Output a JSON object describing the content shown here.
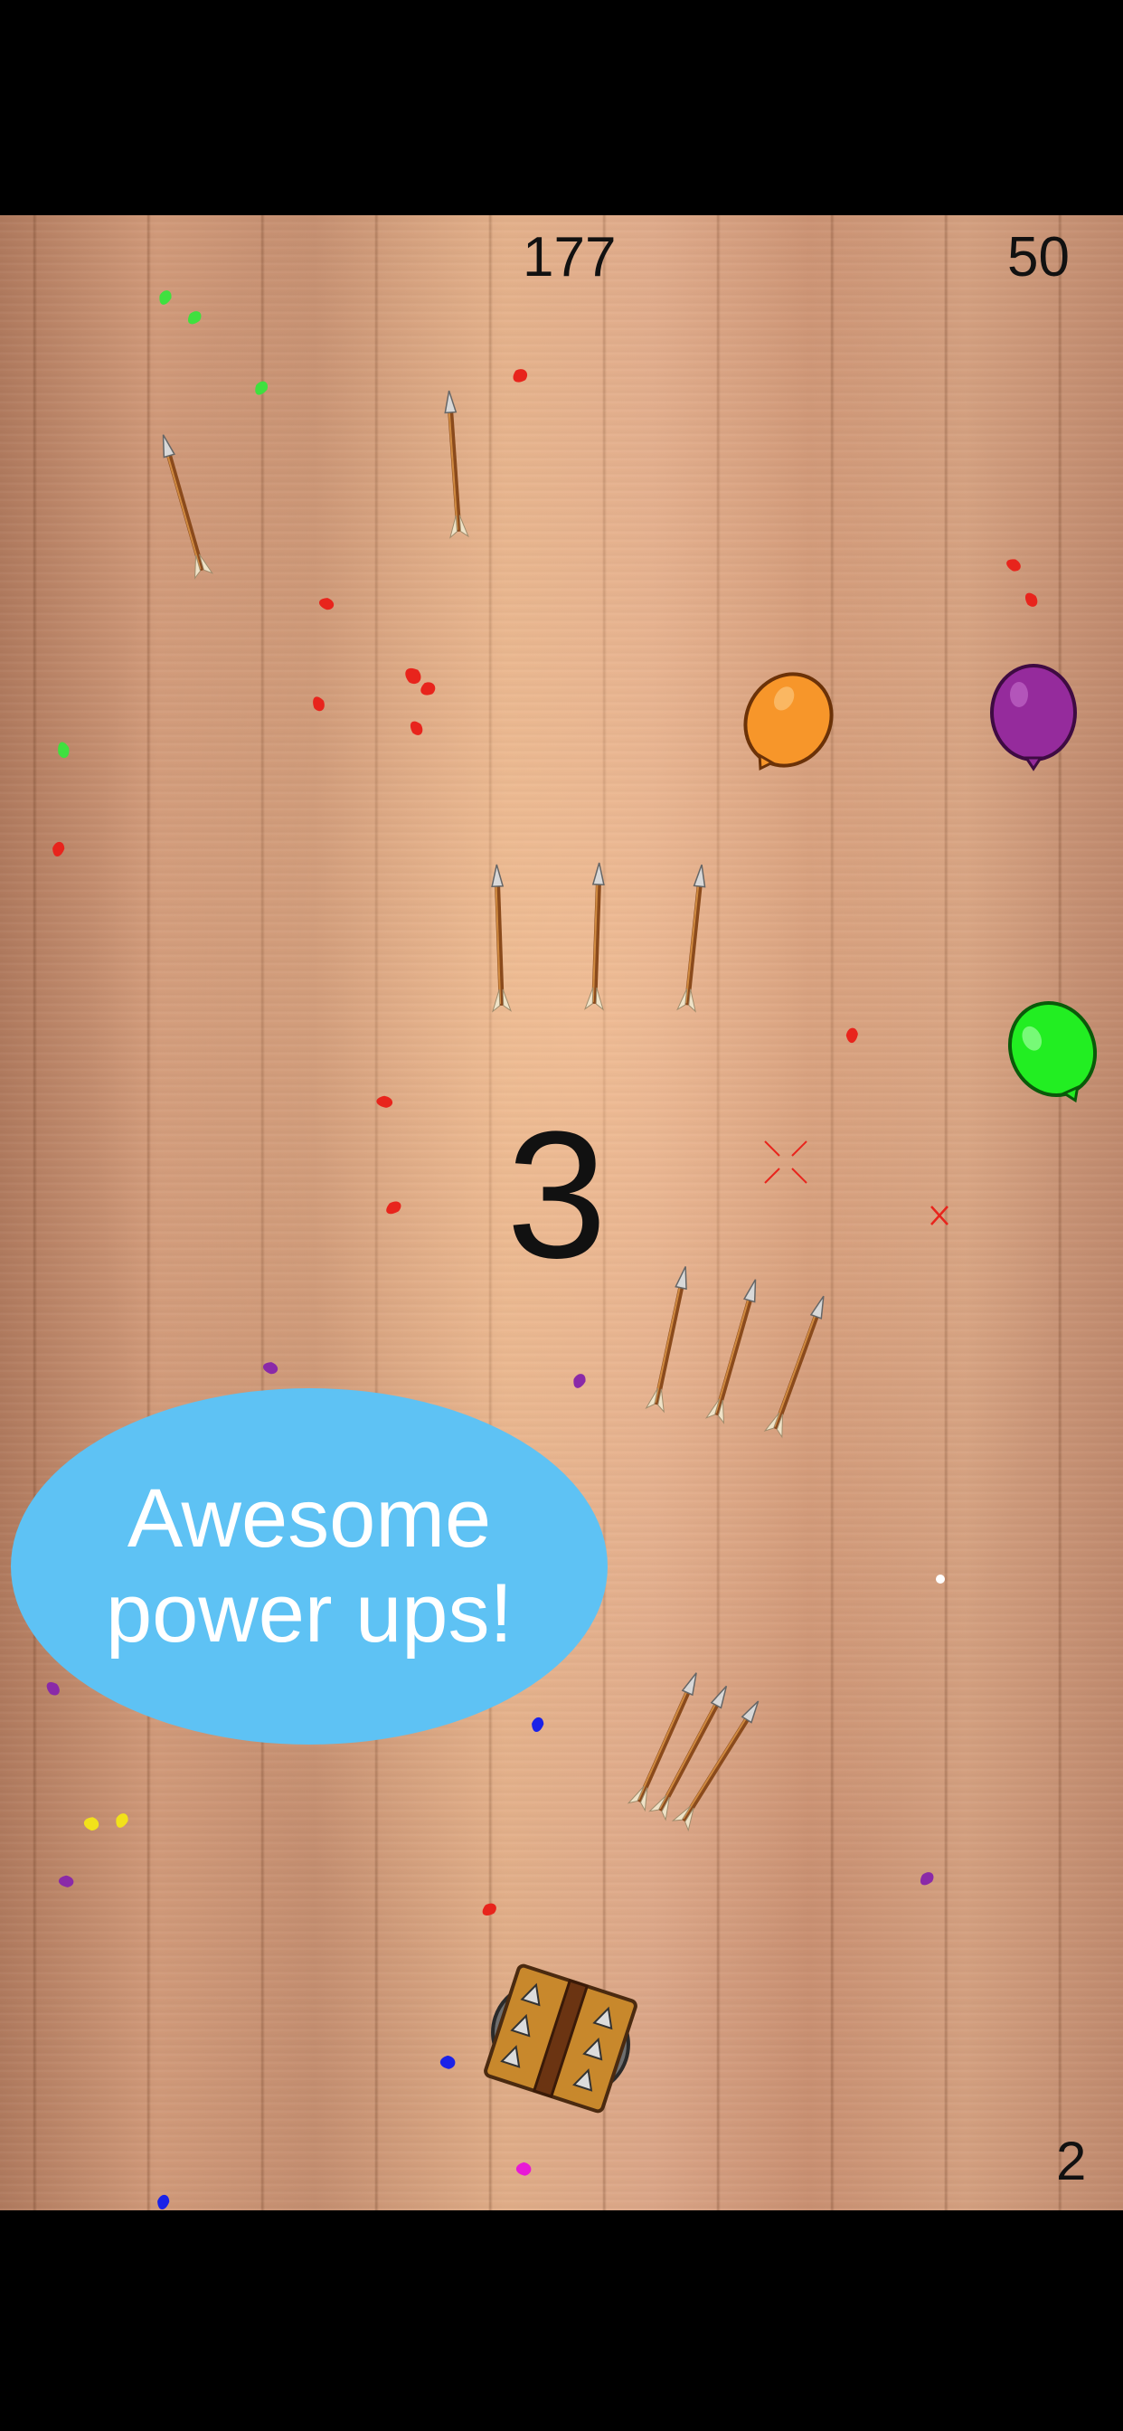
{
  "hud": {
    "score": "177",
    "timer": "50",
    "lives": "2"
  },
  "countdown": "3",
  "promo": {
    "line1": "Awesome",
    "line2": "power ups!"
  },
  "balloons": [
    {
      "color": "orange",
      "hex": "#f7962a"
    },
    {
      "color": "purple",
      "hex": "#952b9c"
    },
    {
      "color": "green",
      "hex": "#22ee22"
    }
  ],
  "powerups": [
    {
      "type": "single-arrow"
    },
    {
      "type": "single-arrow"
    },
    {
      "type": "triple-arrow-parallel"
    },
    {
      "type": "triple-arrow-spread"
    },
    {
      "type": "triple-arrow-fan"
    }
  ],
  "player": {
    "icon": "spiked-shield-icon"
  },
  "icons": [
    "crosshair-icon",
    "x-marker-icon"
  ],
  "colors": {
    "background": "#000000",
    "wood": "#d19a7a",
    "bubble": "#5ec2f4",
    "text": "#111111"
  }
}
